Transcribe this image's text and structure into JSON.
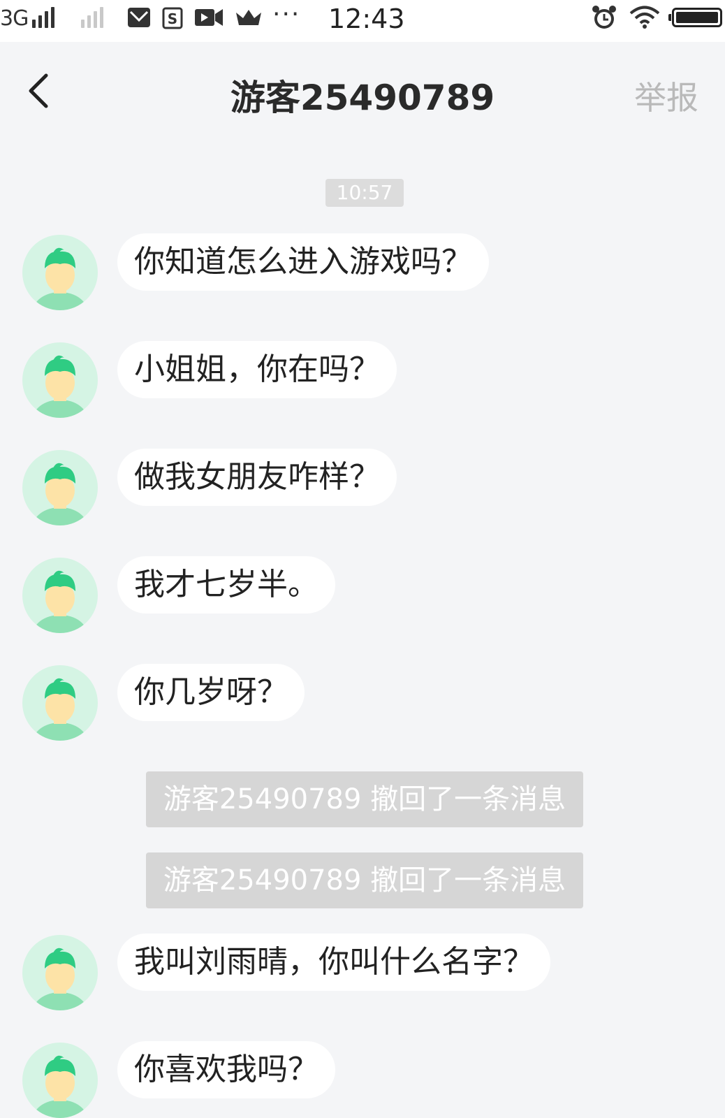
{
  "status_bar": {
    "network": "3G",
    "time": "12:43",
    "more": "···",
    "icons": [
      "signal-icon",
      "signal-weak-icon",
      "mail-icon",
      "s-app-icon",
      "video-icon",
      "crown-icon",
      "alarm-icon",
      "wifi-icon",
      "battery-icon"
    ]
  },
  "nav": {
    "title": "游客25490789",
    "report": "举报"
  },
  "time_chip": "10:57",
  "messages": [
    "你知道怎么进入游戏吗？",
    "小姐姐，你在吗？",
    "做我女朋友咋样？",
    "我才七岁半。",
    "你几岁呀？",
    "我叫刘雨晴，你叫什么名字？",
    "你喜欢我吗？"
  ],
  "recall_notices": [
    "游客25490789 撤回了一条消息",
    "游客25490789 撤回了一条消息"
  ],
  "colors": {
    "background": "#f4f5f7",
    "avatar_bg": "#d5f4e4",
    "avatar_hair": "#2fcc83",
    "avatar_shirt": "#8ee0b3",
    "avatar_skin": "#fde3a7",
    "notice_bg": "#d6d6d6",
    "report_text": "#b9b9b9"
  }
}
